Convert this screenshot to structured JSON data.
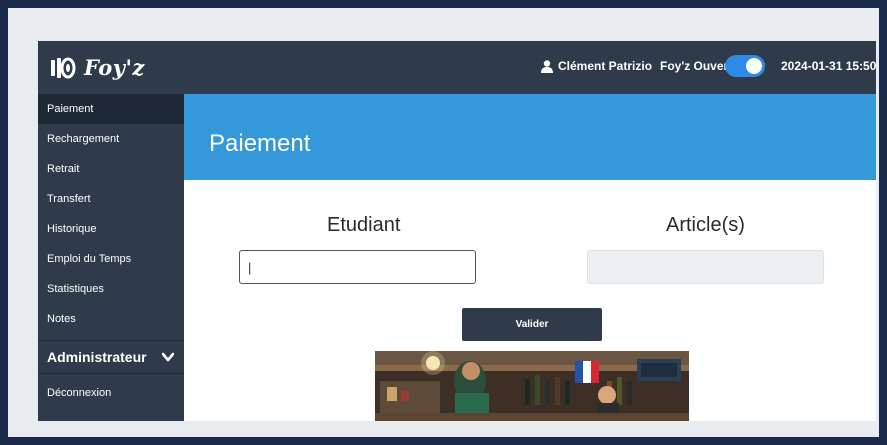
{
  "app": {
    "logo_text": "Foy'z",
    "user_name": "Clément Patrizio",
    "open_label": "Foy'z Ouvert",
    "open_state": true,
    "datetime": "2024-01-31  15:50"
  },
  "sidebar": {
    "items": [
      {
        "label": "Paiement",
        "active": true
      },
      {
        "label": "Rechargement"
      },
      {
        "label": "Retrait"
      },
      {
        "label": "Transfert"
      },
      {
        "label": "Historique"
      },
      {
        "label": "Emploi du Temps"
      },
      {
        "label": "Statistiques"
      },
      {
        "label": "Notes"
      }
    ],
    "section": "Administrateur",
    "logout": "Déconnexion"
  },
  "main": {
    "title": "Paiement",
    "student_label": "Etudiant",
    "article_label": "Article(s)",
    "student_value": "|",
    "submit_label": "Valider"
  },
  "colors": {
    "sidebar": "#2f3b4a",
    "header": "#3498db",
    "toggle": "#2e8ae6",
    "outer": "#1b2a4b"
  },
  "icons": {
    "logo": "barrel-icon",
    "user": "user-icon",
    "section": "chevron-down-icon"
  }
}
